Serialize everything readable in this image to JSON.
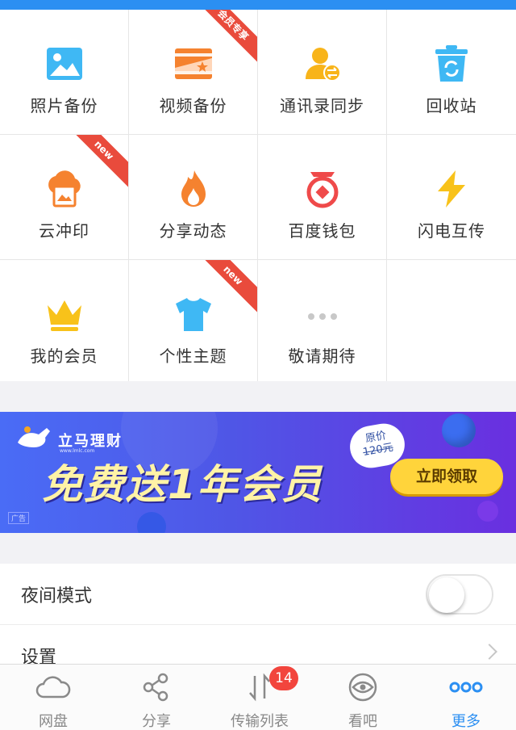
{
  "grid": {
    "items": [
      {
        "label": "照片备份",
        "icon": "photo-icon"
      },
      {
        "label": "视频备份",
        "icon": "video-icon",
        "ribbon": "会员专享"
      },
      {
        "label": "通讯录同步",
        "icon": "contacts-sync-icon"
      },
      {
        "label": "回收站",
        "icon": "recycle-bin-icon"
      },
      {
        "label": "云冲印",
        "icon": "cloud-print-icon",
        "ribbon": "new"
      },
      {
        "label": "分享动态",
        "icon": "fire-icon"
      },
      {
        "label": "百度钱包",
        "icon": "wallet-icon"
      },
      {
        "label": "闪电互传",
        "icon": "lightning-icon"
      },
      {
        "label": "我的会员",
        "icon": "crown-icon"
      },
      {
        "label": "个性主题",
        "icon": "tshirt-icon",
        "ribbon": "new"
      },
      {
        "label": "敬请期待",
        "icon": "more-dots-icon"
      }
    ]
  },
  "banner": {
    "brand": "立马理财",
    "brand_sub": "www.lmlc.com",
    "headline": "免费送1年会员",
    "bubble_top": "原价",
    "bubble_price": "120元",
    "cta": "立即领取",
    "ad_tag": "广告"
  },
  "settings": {
    "night_mode": "夜间模式",
    "night_mode_on": false,
    "settings_label": "设置"
  },
  "tabbar": {
    "tabs": [
      {
        "label": "网盘",
        "icon": "cloud-icon"
      },
      {
        "label": "分享",
        "icon": "share-icon"
      },
      {
        "label": "传输列表",
        "icon": "transfer-icon",
        "badge": "14"
      },
      {
        "label": "看吧",
        "icon": "eye-icon"
      },
      {
        "label": "更多",
        "icon": "more-icon",
        "active": true
      }
    ]
  },
  "colors": {
    "accent": "#2b8ff2",
    "ribbon": "#e94b3c",
    "badge": "#f2453d"
  }
}
